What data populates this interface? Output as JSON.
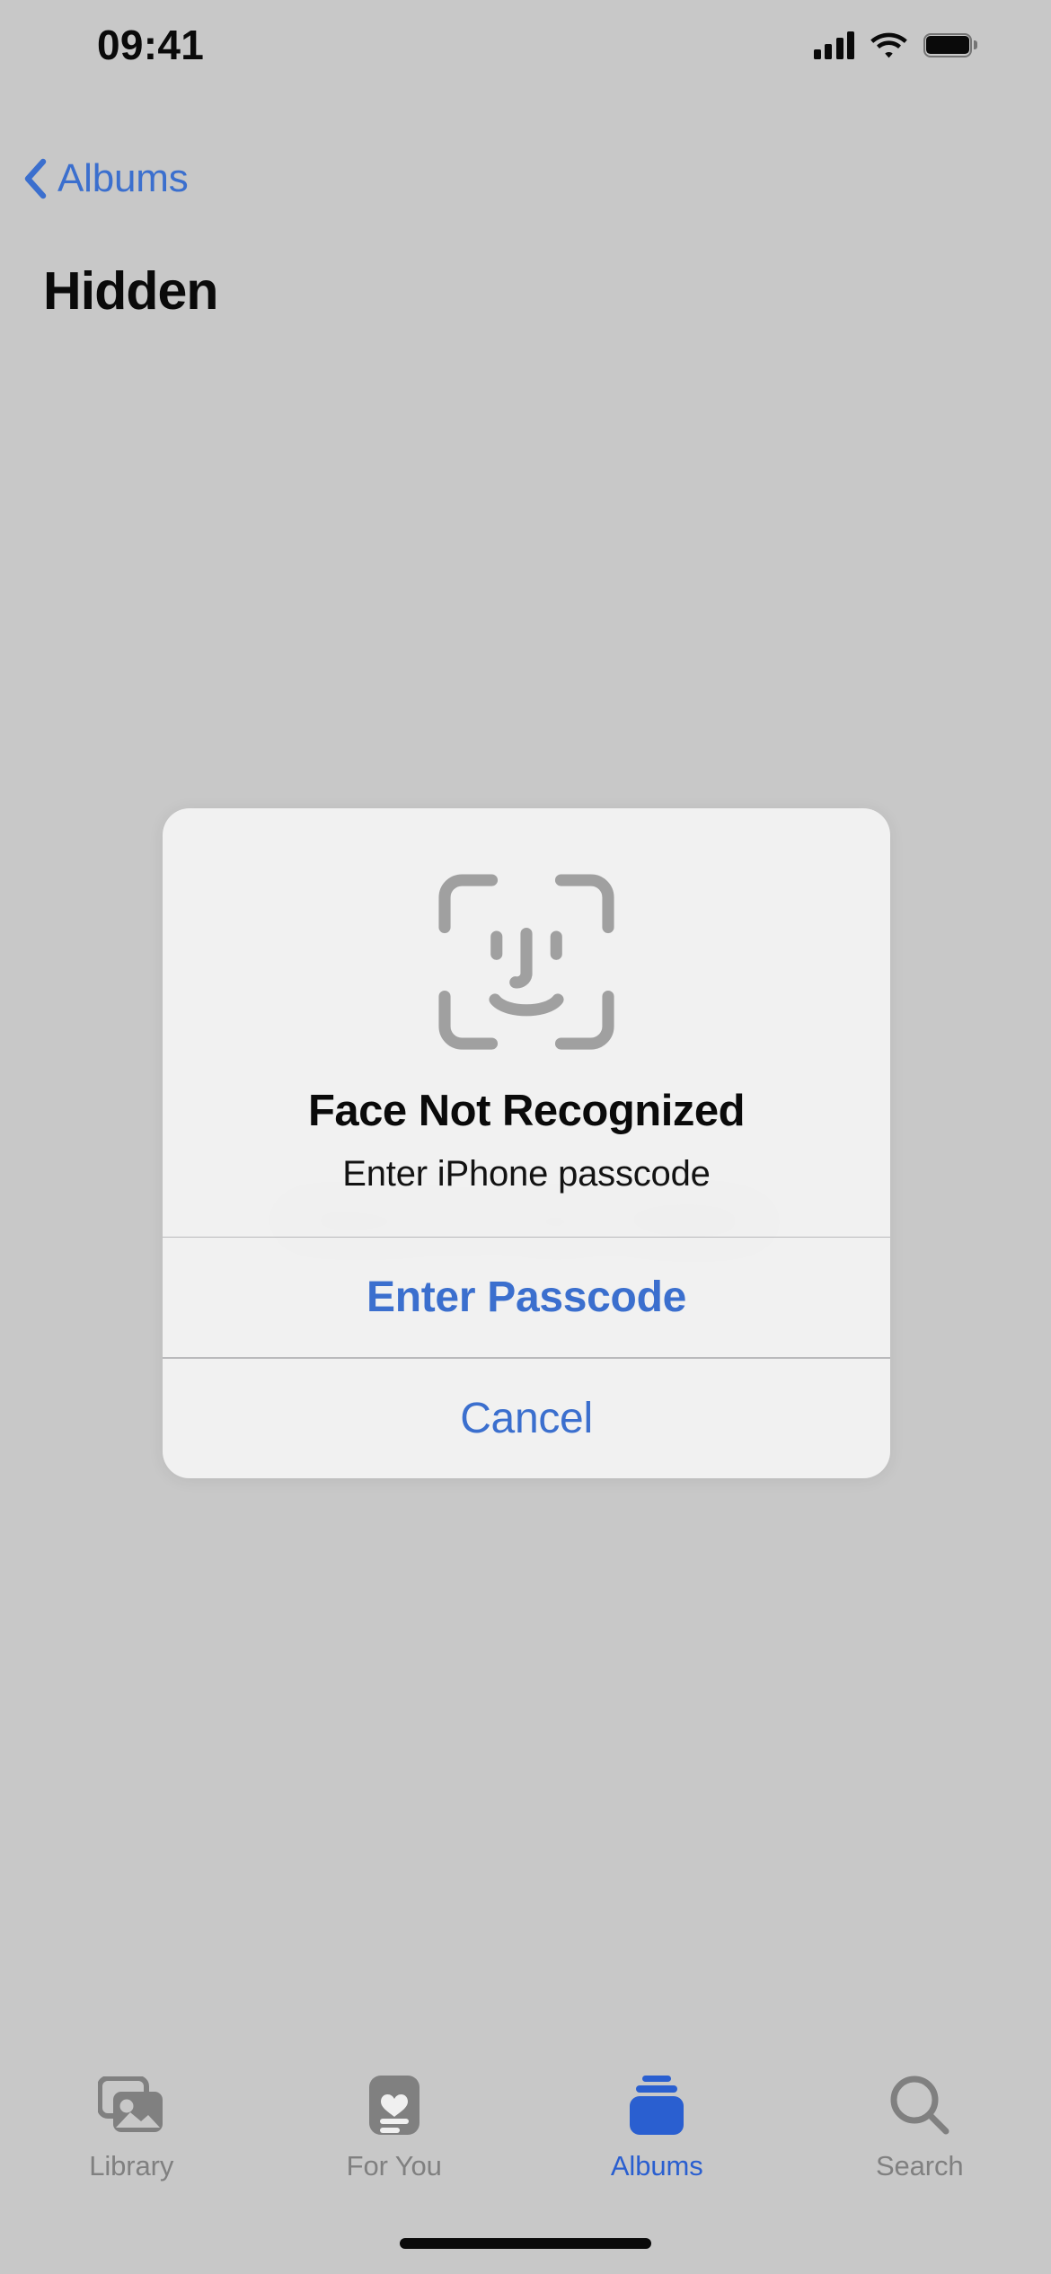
{
  "status_bar": {
    "time": "09:41",
    "cellular_icon": "cellular-signal-icon",
    "wifi_icon": "wifi-icon",
    "battery_icon": "battery-full-icon",
    "signal_bars": 4,
    "battery_level": 100
  },
  "nav": {
    "back_icon": "chevron-left-icon",
    "back_label": "Albums",
    "title": "Hidden"
  },
  "background": {
    "locked_message": "Unlock to view Hidden"
  },
  "alert": {
    "icon": "face-id-icon",
    "title": "Face Not Recognized",
    "subtitle": "Enter iPhone passcode",
    "primary_button": "Enter Passcode",
    "secondary_button": "Cancel"
  },
  "tab_bar": {
    "items": [
      {
        "label": "Library",
        "icon": "photo-stack-icon",
        "active": false
      },
      {
        "label": "For You",
        "icon": "heart-card-icon",
        "active": false
      },
      {
        "label": "Albums",
        "icon": "albums-stack-icon",
        "active": true
      },
      {
        "label": "Search",
        "icon": "search-icon",
        "active": false
      }
    ]
  },
  "colors": {
    "accent": "#3b6fce",
    "tab_active": "#2a5fd0",
    "tab_inactive": "#808080",
    "background": "#c8c8c8",
    "alert_surface": "#f2f2f2"
  },
  "home_indicator": "home-indicator"
}
